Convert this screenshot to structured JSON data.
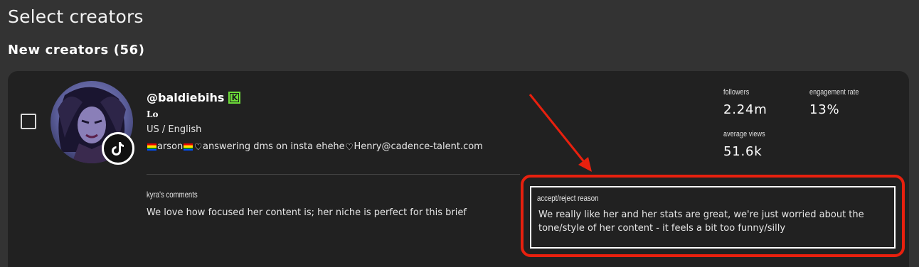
{
  "header": {
    "title": "Select creators",
    "section_title": "New creators (56)"
  },
  "creator": {
    "handle": "@baldiebihs",
    "verified_badge": "K",
    "display_name": "Lo",
    "location": "US / English",
    "bio": {
      "part1": "arson",
      "part2": "answering dms on insta ehehe",
      "part3": "Henry@cadence-talent.com"
    },
    "platform_icon": "tiktok-icon",
    "stats": {
      "followers_label": "followers",
      "followers_value": "2.24m",
      "engagement_label": "engagement rate",
      "engagement_value": "13%",
      "views_label": "average views",
      "views_value": "51.6k"
    },
    "comments_label": "kyra's comments",
    "comments_text": "We love how focused her content is; her niche is perfect for this brief",
    "reason_label": "accept/reject reason",
    "reason_text": "We really like her and her stats are great, we're just worried about the tone/style of her content - it feels a bit too funny/silly"
  },
  "colors": {
    "background": "#333333",
    "card": "#212121",
    "badge_green": "#6ddc39",
    "annotation_red": "#e8200e"
  }
}
